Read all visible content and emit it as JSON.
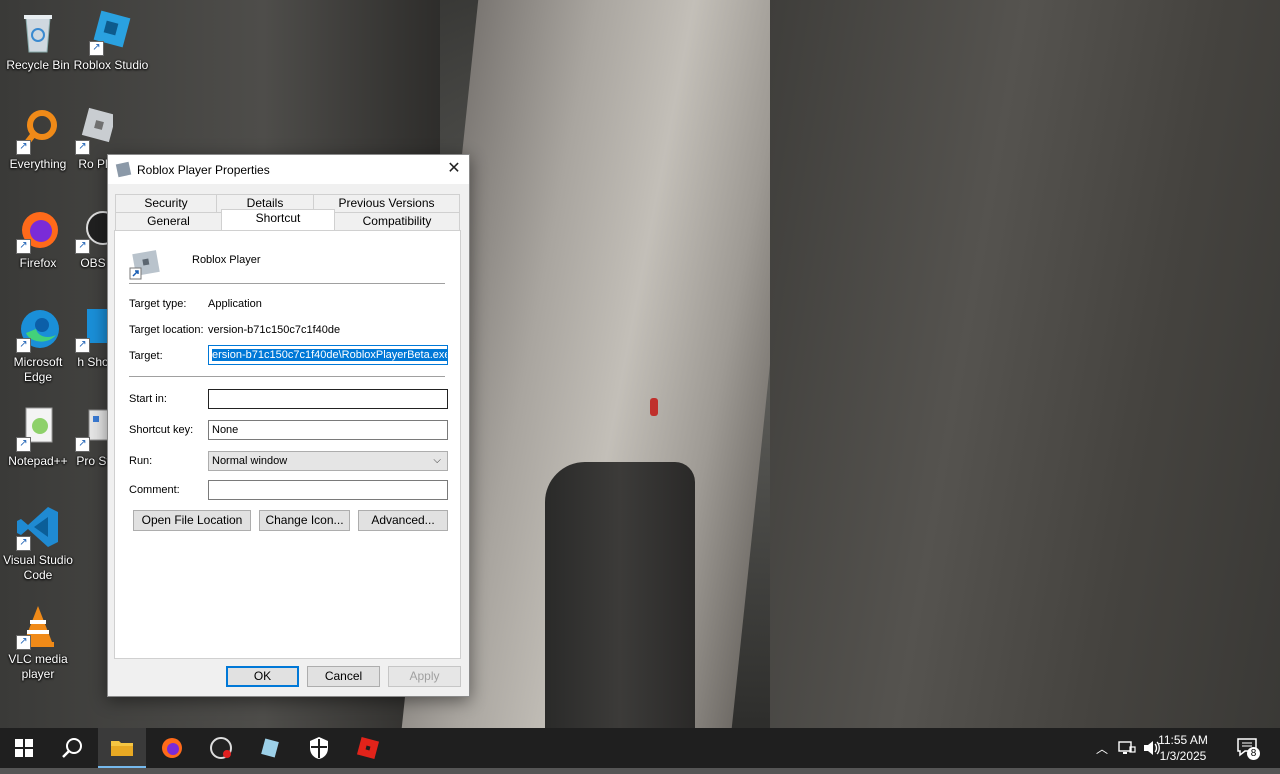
{
  "desktop": {
    "icons": [
      {
        "label": "Recycle Bin",
        "icon": "recycle-bin-icon"
      },
      {
        "label": "Roblox Studio",
        "icon": "roblox-studio-icon"
      },
      {
        "label": "Everything",
        "icon": "everything-search-icon"
      },
      {
        "label": "Ro Pl",
        "icon": "roblox-player-icon"
      },
      {
        "label": "Firefox",
        "icon": "firefox-icon"
      },
      {
        "label": "OBS",
        "icon": "obs-icon"
      },
      {
        "label": "Microsoft Edge",
        "icon": "edge-icon"
      },
      {
        "label": "h Sho",
        "icon": "shortcut-icon"
      },
      {
        "label": "Notepad++",
        "icon": "notepadpp-icon"
      },
      {
        "label": "Pro St",
        "icon": "process-icon"
      },
      {
        "label": "Visual Studio Code",
        "icon": "vscode-icon"
      },
      {
        "label": "VLC media player",
        "icon": "vlc-icon"
      }
    ]
  },
  "dialog": {
    "title": "Roblox Player Properties",
    "close": "✕",
    "tabs_back": [
      "Security",
      "Details",
      "Previous Versions"
    ],
    "tabs_front": [
      "General",
      "Shortcut",
      "Compatibility"
    ],
    "app_name": "Roblox Player",
    "target_type_label": "Target type:",
    "target_type_value": "Application",
    "target_location_label": "Target location:",
    "target_location_value": "version-b71c150c7c1f40de",
    "target_label": "Target:",
    "target_value": "ersion-b71c150c7c1f40de\\RobloxPlayerBeta.exe",
    "start_in_label": "Start in:",
    "start_in_value": "",
    "shortcut_key_label": "Shortcut key:",
    "shortcut_key_value": "None",
    "run_label": "Run:",
    "run_value": "Normal window",
    "comment_label": "Comment:",
    "comment_value": "",
    "open_file_location": "Open File Location",
    "change_icon": "Change Icon...",
    "advanced": "Advanced...",
    "ok": "OK",
    "cancel": "Cancel",
    "apply": "Apply"
  },
  "taskbar": {
    "time": "11:55 AM",
    "date": "1/3/2025",
    "notification_count": "8"
  }
}
